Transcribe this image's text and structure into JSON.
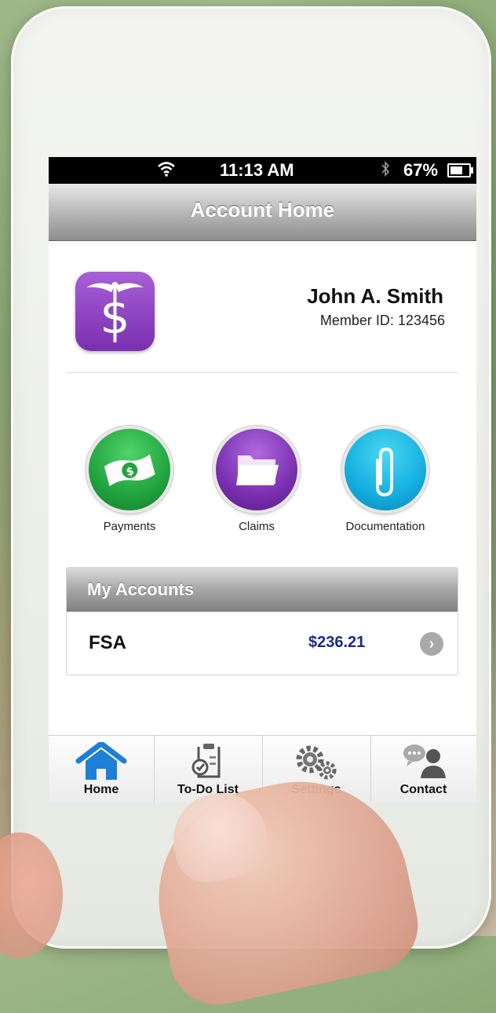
{
  "status_bar": {
    "time": "11:13 AM",
    "battery": "67%",
    "battery_level": 0.67,
    "wifi_icon": "wifi-icon",
    "bluetooth_icon": "bluetooth-icon"
  },
  "nav": {
    "title": "Account Home"
  },
  "profile": {
    "name": "John A. Smith",
    "member_id": "Member ID: 123456",
    "logo_icon": "caduceus-dollar-icon"
  },
  "actions": [
    {
      "label": "Payments",
      "icon": "money-icon",
      "color": "#21a33e"
    },
    {
      "label": "Claims",
      "icon": "folder-icon",
      "color": "#7a2fb0"
    },
    {
      "label": "Documentation",
      "icon": "paperclip-icon",
      "color": "#14aee0"
    }
  ],
  "accounts": {
    "header": "My Accounts",
    "rows": [
      {
        "name": "FSA",
        "amount": "$236.21"
      }
    ]
  },
  "tabs": [
    {
      "label": "Home",
      "icon": "home-icon",
      "active": true
    },
    {
      "label": "To-Do List",
      "icon": "clipboard-icon",
      "active": false
    },
    {
      "label": "Settings",
      "icon": "gears-icon",
      "active": false
    },
    {
      "label": "Contact",
      "icon": "contact-icon",
      "active": false
    }
  ],
  "colors": {
    "accent_blue": "#1d7fd6",
    "amount_blue": "#1a2a8a",
    "app_purple": "#7a2fb0"
  }
}
